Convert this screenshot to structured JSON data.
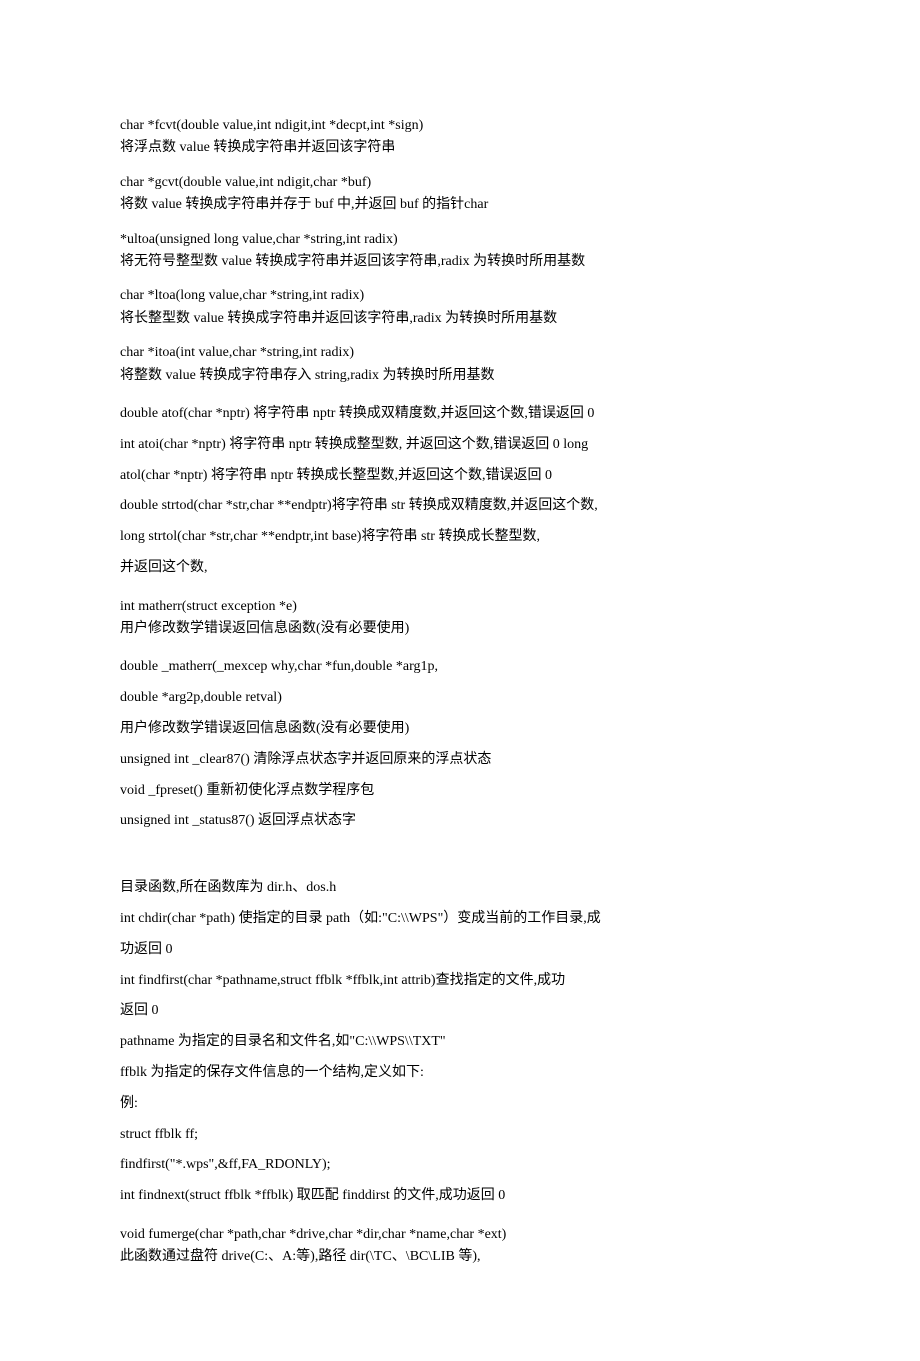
{
  "blocks": [
    {
      "tight": true,
      "lines": [
        "char *fcvt(double value,int ndigit,int *decpt,int *sign)",
        "将浮点数 value 转换成字符串并返回该字符串"
      ]
    },
    {
      "tight": true,
      "lines": [
        "char *gcvt(double value,int ndigit,char *buf)",
        "将数 value 转换成字符串并存于 buf 中,并返回 buf 的指针char"
      ]
    },
    {
      "tight": true,
      "lines": [
        "*ultoa(unsigned long value,char *string,int radix)",
        "将无符号整型数 value 转换成字符串并返回该字符串,radix 为转换时所用基数"
      ]
    },
    {
      "tight": true,
      "lines": [
        "char *ltoa(long value,char *string,int radix)",
        "将长整型数 value 转换成字符串并返回该字符串,radix 为转换时所用基数"
      ]
    },
    {
      "tight": true,
      "lines": [
        "char *itoa(int value,char *string,int radix)",
        "将整数 value 转换成字符串存入 string,radix 为转换时所用基数"
      ]
    },
    {
      "tight": false,
      "lines": [
        "double atof(char *nptr) 将字符串 nptr 转换成双精度数,并返回这个数,错误返回 0",
        "int atoi(char *nptr) 将字符串 nptr 转换成整型数, 并返回这个数,错误返回 0 long",
        "atol(char *nptr) 将字符串 nptr 转换成长整型数,并返回这个数,错误返回 0",
        "double strtod(char *str,char **endptr)将字符串 str 转换成双精度数,并返回这个数,",
        "long strtol(char *str,char **endptr,int base)将字符串 str 转换成长整型数,",
        "并返回这个数,"
      ]
    },
    {
      "tight": true,
      "lines": [
        "int matherr(struct exception *e)",
        "用户修改数学错误返回信息函数(没有必要使用)"
      ]
    },
    {
      "tight": false,
      "lines": [
        "double _matherr(_mexcep why,char *fun,double *arg1p,",
        "double *arg2p,double retval)",
        "用户修改数学错误返回信息函数(没有必要使用)",
        "unsigned int _clear87() 清除浮点状态字并返回原来的浮点状态",
        "void _fpreset() 重新初使化浮点数学程序包",
        "unsigned int _status87() 返回浮点状态字"
      ]
    },
    {
      "spacer": true
    },
    {
      "tight": false,
      "lines": [
        "目录函数,所在函数库为 dir.h、dos.h",
        "int chdir(char *path) 使指定的目录 path（如:\"C:\\\\WPS\"）变成当前的工作目录,成",
        "功返回 0",
        "int findfirst(char *pathname,struct ffblk *ffblk,int attrib)查找指定的文件,成功",
        "返回 0",
        "pathname 为指定的目录名和文件名,如\"C:\\\\WPS\\\\TXT\"",
        "ffblk 为指定的保存文件信息的一个结构,定义如下:",
        "例:",
        "struct ffblk ff;",
        "findfirst(\"*.wps\",&ff,FA_RDONLY);",
        "int findnext(struct ffblk *ffblk) 取匹配 finddirst 的文件,成功返回 0"
      ]
    },
    {
      "tight": true,
      "lines": [
        "void fumerge(char *path,char *drive,char *dir,char *name,char *ext)",
        "此函数通过盘符 drive(C:、A:等),路径 dir(\\TC、\\BC\\LIB 等),"
      ]
    }
  ]
}
